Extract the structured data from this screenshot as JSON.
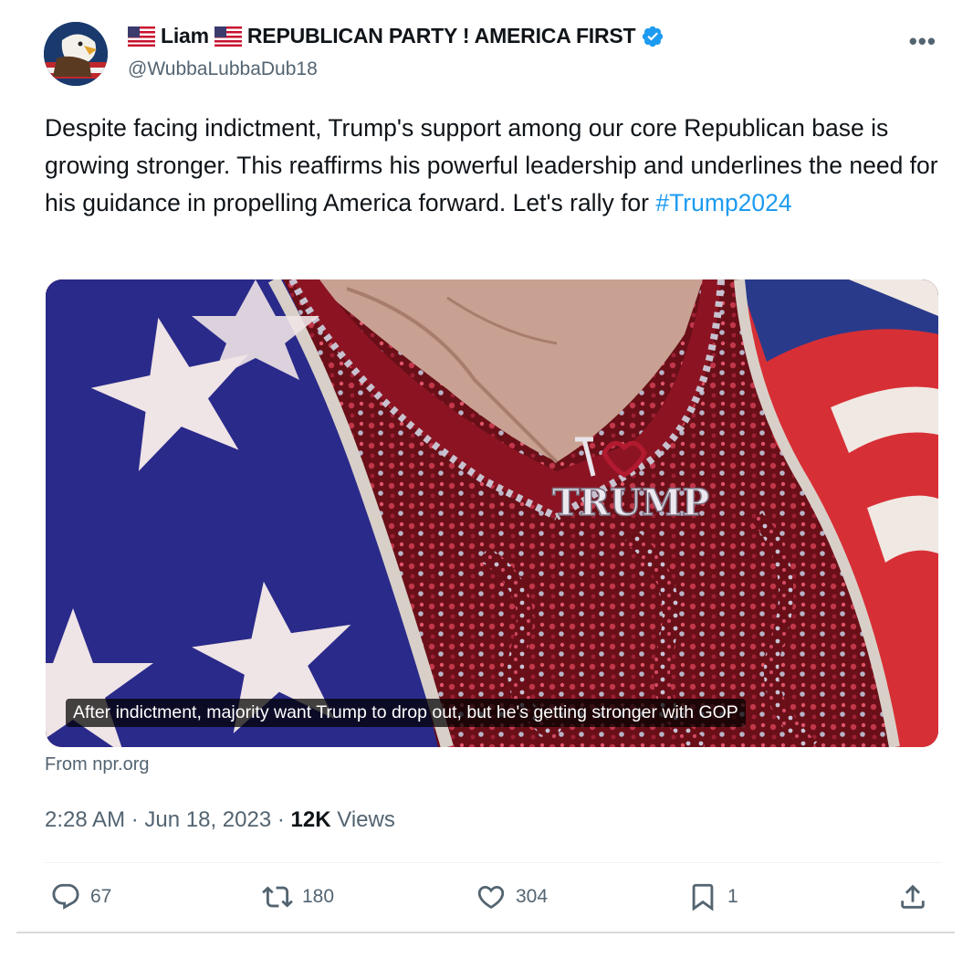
{
  "author": {
    "display_name": "Liam",
    "display_name_suffix": "REPUBLICAN PARTY ! AMERICA FIRST",
    "handle": "@WubbaLubbaDub18",
    "verified": true,
    "verified_color": "#1d9bf0"
  },
  "tweet": {
    "text": "Despite facing indictment, Trump's support among our core Republican base is growing stronger. This reaffirms his powerful leadership and underlines the need for his guidance in propelling America forward. Let's rally for ",
    "hashtag": "#Trump2024",
    "hashtag_color": "#1d9bf0"
  },
  "card": {
    "headline": "After indictment, majority want Trump to drop out, but he's getting stronger with GOP",
    "pendant_text": "TRUMP",
    "source": "From npr.org"
  },
  "meta": {
    "time": "2:28 AM",
    "separator": "·",
    "date": "Jun 18, 2023",
    "views_count": "12K",
    "views_label": "Views"
  },
  "actions": {
    "replies": "67",
    "reposts": "180",
    "likes": "304",
    "bookmarks": "1"
  },
  "colors": {
    "text_primary": "#0f1419",
    "text_secondary": "#536471",
    "divider": "#eff3f4"
  }
}
